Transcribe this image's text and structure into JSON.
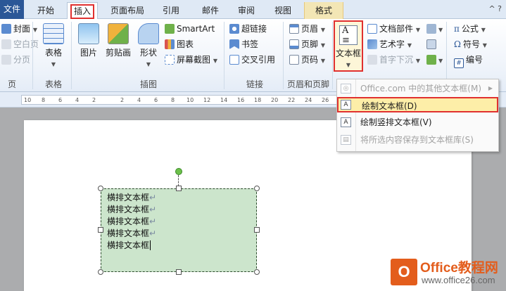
{
  "tabs": [
    "文件",
    "开始",
    "插入",
    "页面布局",
    "引用",
    "邮件",
    "审阅",
    "视图",
    "格式"
  ],
  "help": "^ ?",
  "ribbon": {
    "pages": {
      "cover": "封面",
      "blank": "空白页",
      "break": "分页",
      "title": "页"
    },
    "table": {
      "label": "表格",
      "title": "表格"
    },
    "illustrations": {
      "picture": "图片",
      "clipart": "剪贴画",
      "shapes": "形状",
      "smartart": "SmartArt",
      "chart": "图表",
      "screenshot": "屏幕截图",
      "title": "插图"
    },
    "links": {
      "hyperlink": "超链接",
      "bookmark": "书签",
      "crossref": "交叉引用",
      "title": "链接"
    },
    "header_footer": {
      "header": "页眉",
      "footer": "页脚",
      "page_number": "页码",
      "title": "页眉和页脚"
    },
    "text": {
      "textbox": "文本框",
      "quickparts": "文档部件",
      "wordart": "艺术字",
      "dropcap": "首字下沉"
    },
    "symbols": {
      "equation": "公式",
      "symbol": "符号",
      "number": "编号"
    }
  },
  "ruler_numbers": [
    "10",
    "8",
    "6",
    "4",
    "2",
    "2",
    "4",
    "6",
    "8",
    "10",
    "12",
    "14",
    "16",
    "18",
    "20",
    "22",
    "24",
    "26",
    "28",
    "30",
    "32"
  ],
  "textbox_lines": [
    "横排文本框",
    "横排文本框",
    "横排文本框",
    "横排文本框",
    "横排文本框"
  ],
  "dropdown": {
    "more": "Office.com 中的其他文本框(M)",
    "draw": "绘制文本框(D)",
    "draw_vertical": "绘制竖排文本框(V)",
    "save": "将所选内容保存到文本框库(S)"
  },
  "watermark": {
    "logo": "O",
    "name": "Office教程网",
    "url": "www.office26.com"
  },
  "colors": {
    "accent": "#e0302f",
    "textbox_fill": "#cce5cc",
    "file_tab": "#2b5797",
    "watermark": "#e35d1c"
  }
}
